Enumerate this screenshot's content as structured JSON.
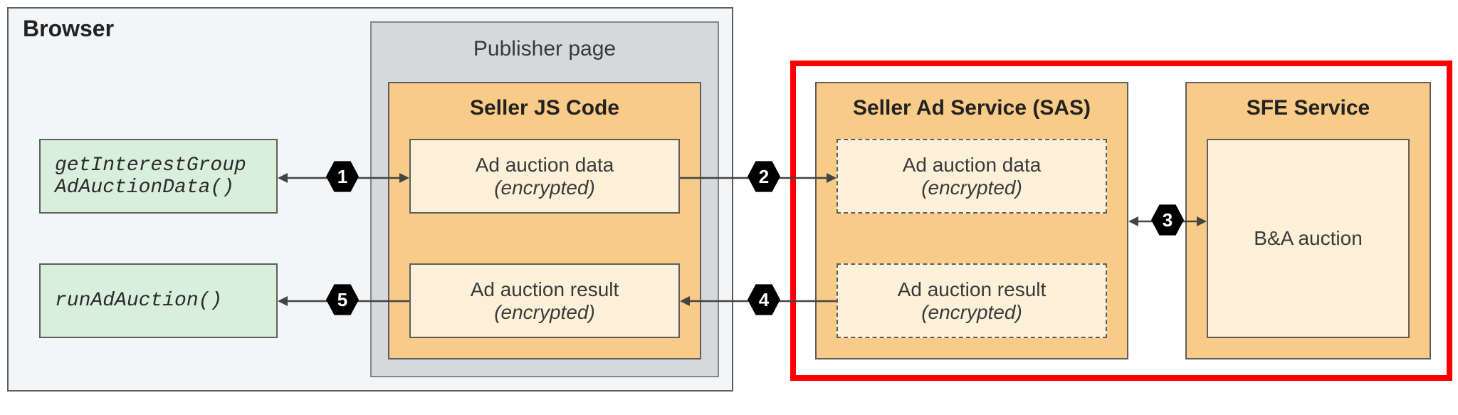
{
  "browser": {
    "title": "Browser"
  },
  "publisher": {
    "title": "Publisher page"
  },
  "sellerJs": {
    "title": "Seller JS Code",
    "adData": {
      "line1": "Ad auction data",
      "line2": "(encrypted)"
    },
    "adResult": {
      "line1": "Ad auction result",
      "line2": "(encrypted)"
    }
  },
  "apis": {
    "get": "getInterestGroup AdAuctionData()",
    "run": "runAdAuction()"
  },
  "sas": {
    "title": "Seller Ad Service (SAS)",
    "adData": {
      "line1": "Ad auction data",
      "line2": "(encrypted)"
    },
    "adResult": {
      "line1": "Ad auction result",
      "line2": "(encrypted)"
    }
  },
  "sfe": {
    "title": "SFE Service",
    "body": "B&A auction"
  },
  "steps": {
    "s1": "1",
    "s2": "2",
    "s3": "3",
    "s4": "4",
    "s5": "5"
  }
}
